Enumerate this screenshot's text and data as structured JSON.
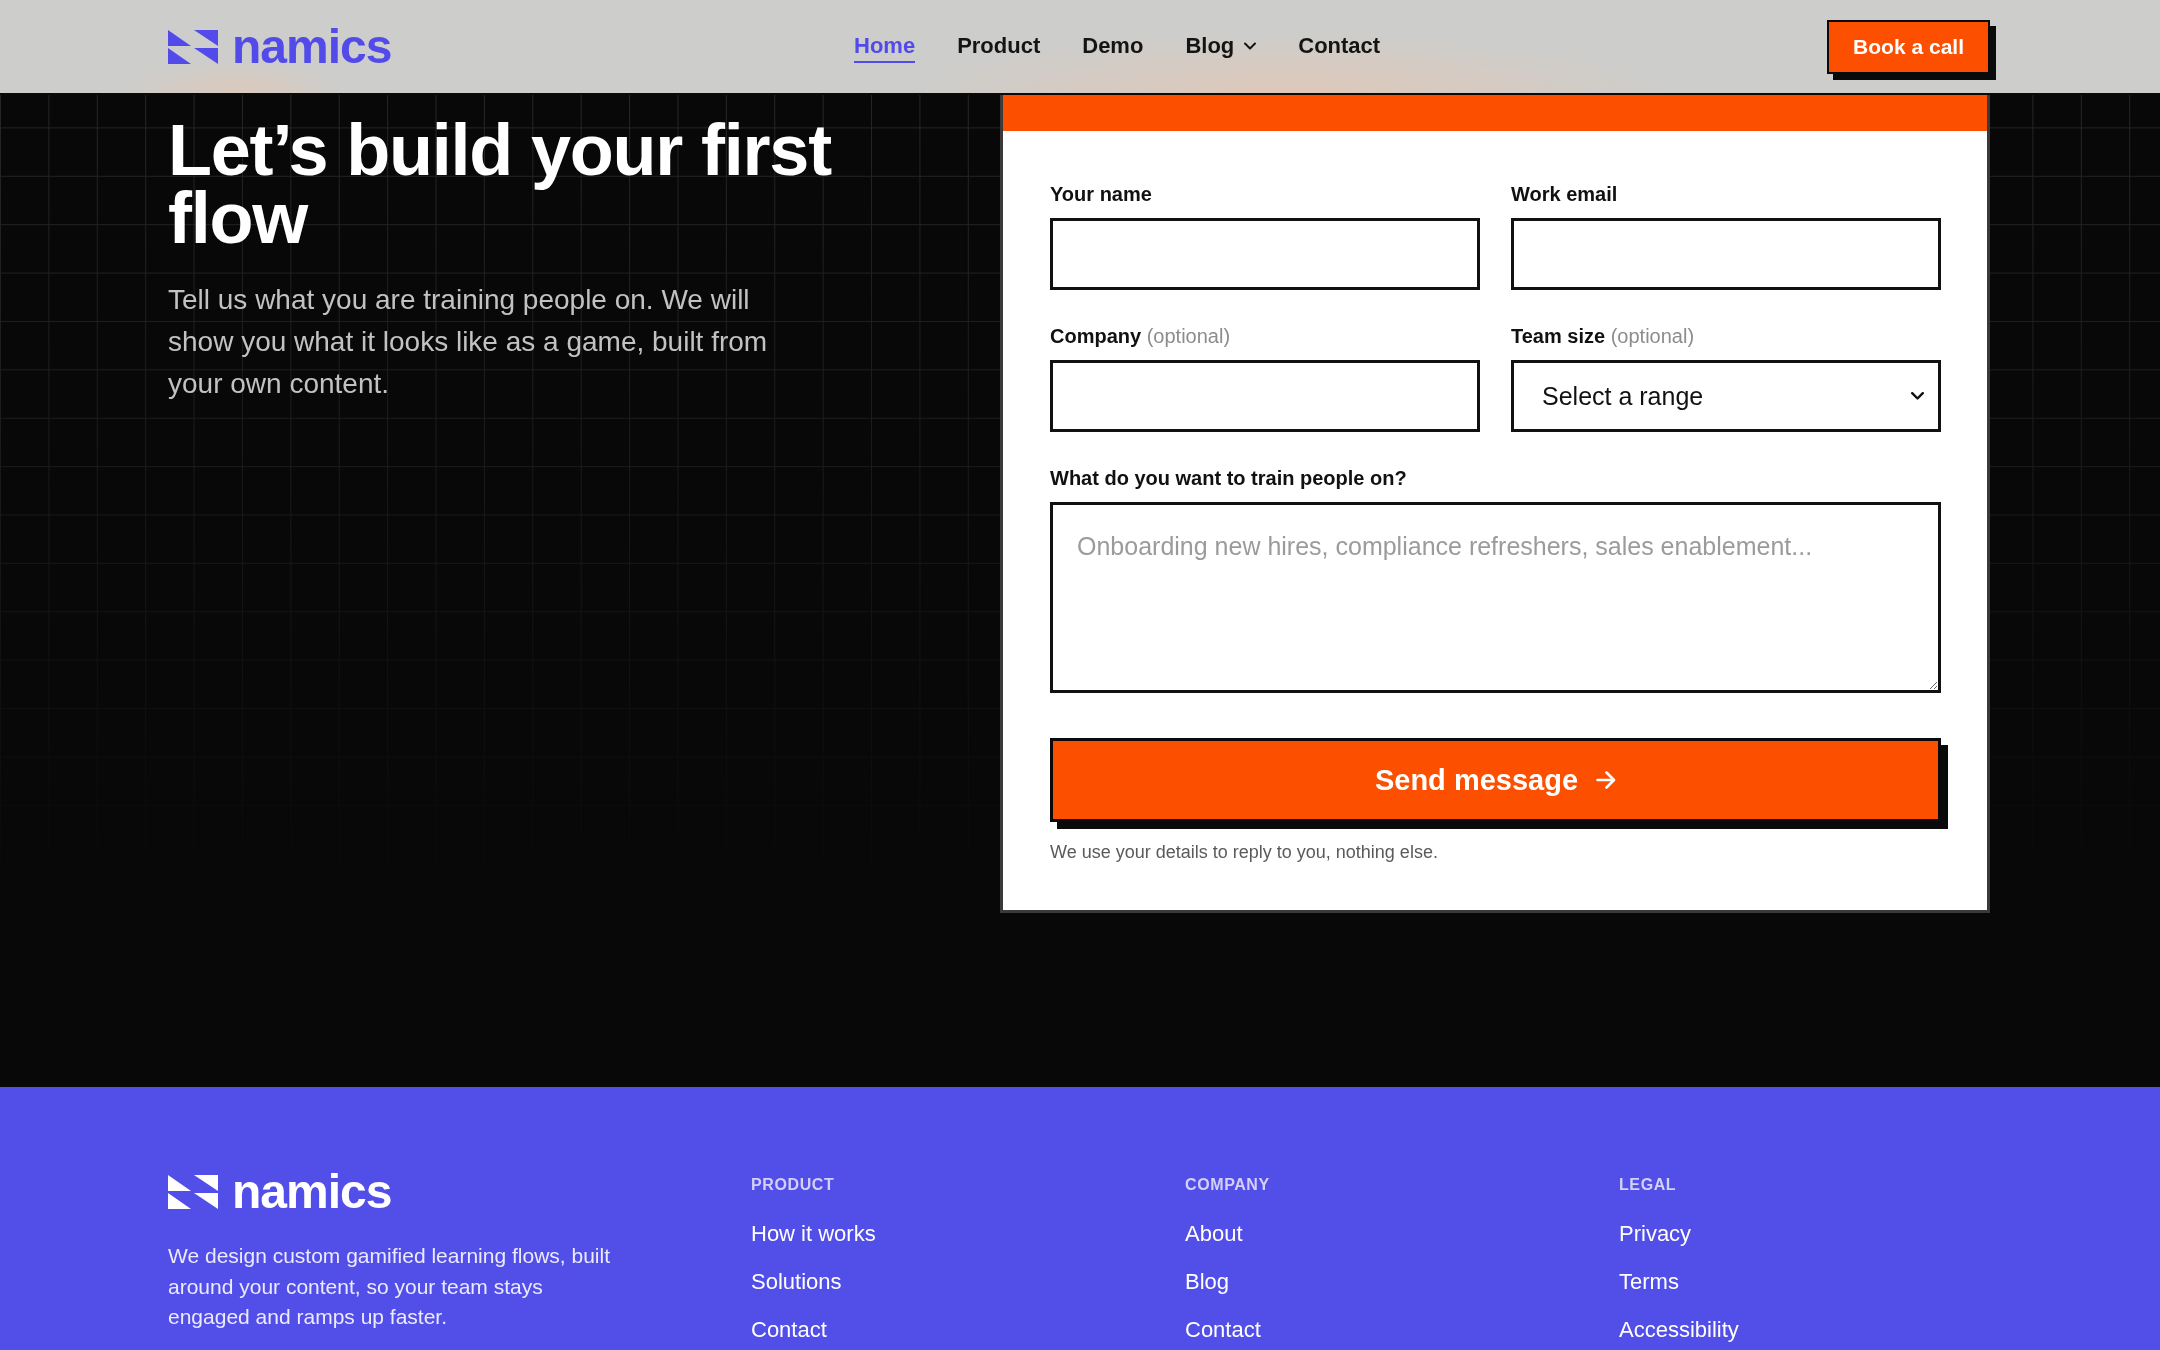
{
  "header": {
    "logo": "namics",
    "nav": [
      {
        "label": "Home",
        "kind": "link",
        "selected": true
      },
      {
        "label": "Product",
        "kind": "link",
        "selected": false
      },
      {
        "label": "Demo",
        "kind": "link",
        "selected": false
      },
      {
        "label": "Blog",
        "kind": "dropdown",
        "selected": false
      },
      {
        "label": "Contact",
        "kind": "link",
        "selected": false
      }
    ],
    "cta": "Book a call"
  },
  "hero": {
    "title": "Let’s build your first flow",
    "text": "Tell us what you are training people on. We will show you what it looks like as a game, built from your own content."
  },
  "form": {
    "fields": [
      {
        "kind": "input",
        "label": "Your name"
      },
      {
        "kind": "input",
        "label": "Work email"
      },
      {
        "kind": "input",
        "label": "Company",
        "hint": "(optional)"
      },
      {
        "kind": "select",
        "label": "Team size",
        "hint": "(optional)",
        "value": "Select a range"
      },
      {
        "kind": "textarea",
        "label": "What do you want to train people on?",
        "placeholder": "Onboarding new hires, compliance refreshers, sales enablement..."
      }
    ],
    "submit": "Send message",
    "note": "We use your details to reply to you, nothing else."
  },
  "footer": {
    "logo": "namics",
    "description": "We design custom gamified learning flows, built around your content, so your team stays engaged and ramps up faster.",
    "columns": [
      {
        "heading": "PRODUCT",
        "links": [
          "How it works",
          "Solutions",
          "Contact"
        ]
      },
      {
        "heading": "COMPANY",
        "links": [
          "About",
          "Blog",
          "Contact"
        ]
      },
      {
        "heading": "LEGAL",
        "links": [
          "Privacy",
          "Terms",
          "Accessibility"
        ]
      }
    ]
  }
}
